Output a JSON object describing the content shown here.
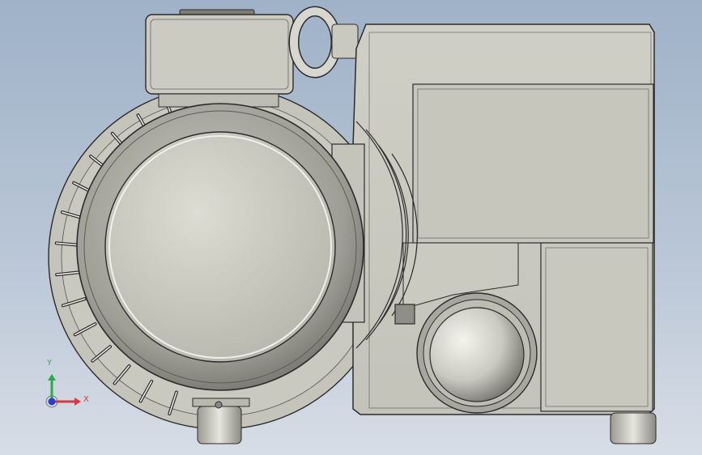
{
  "viewport": {
    "background_top": "#9fb2c8",
    "background_bottom": "#d7dde6"
  },
  "model": {
    "body_color": "#c9c9bf",
    "edge_color": "#2b2b2b",
    "metal_light": "#e4e4dc",
    "metal_dark": "#8e8e86"
  },
  "triad": {
    "x_label": "X",
    "y_label": "Y",
    "x_color": "#d23c3c",
    "y_color": "#2fa84a",
    "z_color": "#2b3fc8"
  }
}
